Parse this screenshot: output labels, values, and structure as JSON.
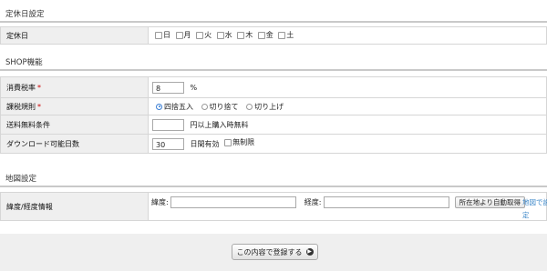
{
  "holidays": {
    "section_title": "定休日設定",
    "label": "定休日",
    "days": [
      "日",
      "月",
      "火",
      "水",
      "木",
      "金",
      "土"
    ]
  },
  "shop": {
    "section_title": "SHOP機能",
    "tax_rate": {
      "label": "消費税率",
      "required_mark": "*",
      "value": "8",
      "unit": "%"
    },
    "tax_rule": {
      "label": "課税規則",
      "required_mark": "*",
      "options": [
        "四捨五入",
        "切り捨て",
        "切り上げ"
      ],
      "selected": "四捨五入"
    },
    "free_shipping": {
      "label": "送料無料条件",
      "value": "",
      "suffix": "円以上購入時無料"
    },
    "download_days": {
      "label": "ダウンロード可能日数",
      "value": "30",
      "suffix": "日間有効",
      "unlimited_label": "無制限"
    }
  },
  "map": {
    "section_title": "地図設定",
    "label": "緯度/経度情報",
    "lat_label": "緯度:",
    "lng_label": "経度:",
    "lat_value": "",
    "lng_value": "",
    "auto_button": "所在地より自動取得",
    "link_text": "地図で設定"
  },
  "submit_label": "この内容で登録する",
  "icons": {
    "submit_arrow": "arrow-right-circle-icon"
  }
}
